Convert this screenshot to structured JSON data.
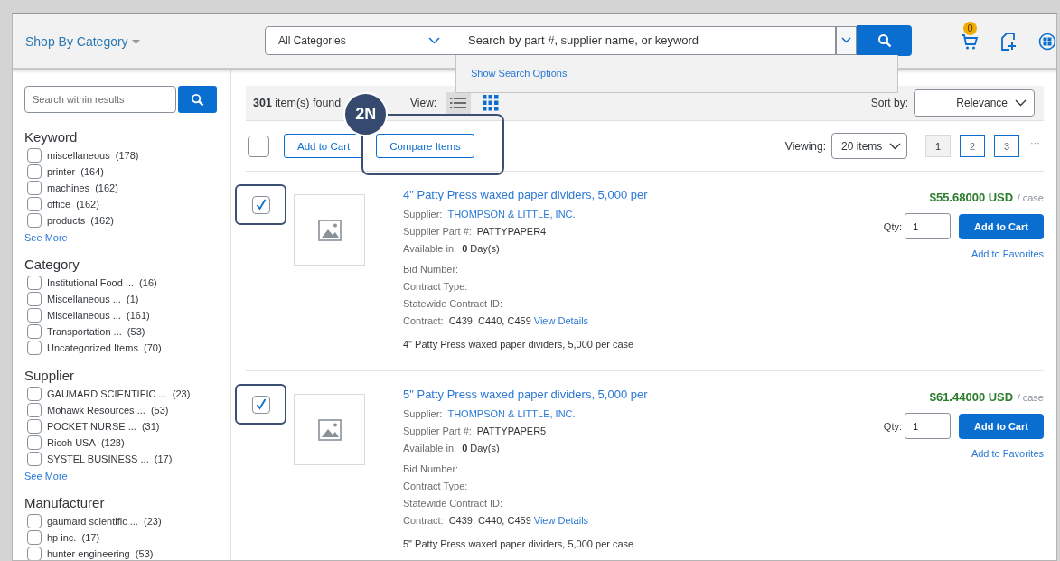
{
  "header": {
    "category_menu": "Shop By Category",
    "category_select": "All Categories",
    "search_placeholder": "Search by part #, supplier name, or keyword",
    "search_options_link": "Show Search Options",
    "cart_count": "0"
  },
  "sidebar": {
    "search_placeholder": "Search within results",
    "groups": [
      {
        "title": "Keyword",
        "see_more": "See More",
        "items": [
          {
            "label": "miscellaneous",
            "count": "(178)",
            "checked": false
          },
          {
            "label": "printer",
            "count": "(164)",
            "checked": false
          },
          {
            "label": "machines",
            "count": "(162)",
            "checked": false
          },
          {
            "label": "office",
            "count": "(162)",
            "checked": false
          },
          {
            "label": "products",
            "count": "(162)",
            "checked": false
          }
        ]
      },
      {
        "title": "Category",
        "items": [
          {
            "label": "Institutional Food ...",
            "count": "(16)",
            "checked": false
          },
          {
            "label": "Miscellaneous ...",
            "count": "(1)",
            "checked": false
          },
          {
            "label": "Miscellaneous ...",
            "count": "(161)",
            "checked": false
          },
          {
            "label": "Transportation ...",
            "count": "(53)",
            "checked": false
          },
          {
            "label": "Uncategorized Items",
            "count": "(70)",
            "checked": false
          }
        ]
      },
      {
        "title": "Supplier",
        "see_more": "See More",
        "items": [
          {
            "label": "GAUMARD SCIENTIFIC ...",
            "count": "(23)",
            "checked": false
          },
          {
            "label": "Mohawk Resources ...",
            "count": "(53)",
            "checked": false
          },
          {
            "label": "POCKET NURSE ...",
            "count": "(31)",
            "checked": false
          },
          {
            "label": "Ricoh USA",
            "count": "(128)",
            "checked": false
          },
          {
            "label": "SYSTEL BUSINESS ...",
            "count": "(17)",
            "checked": false
          }
        ]
      },
      {
        "title": "Manufacturer",
        "items": [
          {
            "label": "gaumard scientific ...",
            "count": "(23)",
            "checked": false
          },
          {
            "label": "hp inc.",
            "count": "(17)",
            "checked": false
          },
          {
            "label": "hunter engineering",
            "count": "(53)",
            "checked": false
          }
        ]
      }
    ]
  },
  "results": {
    "count": "301",
    "count_suffix": "item(s) found",
    "view_label": "View:",
    "view_modes": [
      {
        "kind": "list",
        "selected": true
      },
      {
        "kind": "grid",
        "selected": false
      }
    ],
    "sort_label": "Sort by:",
    "sort_value": "Relevance",
    "select_all_checked": false,
    "buttons": [
      {
        "label": "Add to Cart",
        "highlighted": false
      },
      {
        "label": "Compare Items",
        "highlighted": true
      }
    ],
    "viewing_label": "Viewing:",
    "viewing_value": "20 items",
    "pages": [
      {
        "label": "1",
        "selected": true
      },
      {
        "label": "2",
        "selected": false
      },
      {
        "label": "3",
        "selected": false
      }
    ],
    "more": "···"
  },
  "annotation": {
    "label": "2N"
  },
  "products": [
    {
      "checked": true,
      "highlighted": true,
      "title": "4\" Patty Press waxed paper dividers, 5,000 per",
      "supplier_label": "Supplier:",
      "supplier": "THOMPSON & LITTLE, INC.",
      "part_label": "Supplier Part #:",
      "part": "PATTYPAPER4",
      "available_label": "Available in:",
      "available_days": "0",
      "available_unit": "Day(s)",
      "fields": [
        "Bid Number:",
        "Contract Type:",
        "Statewide Contract ID:"
      ],
      "contract_label": "Contract:",
      "contract": "C439, C440, C459",
      "contract_link": "View Details",
      "description": "4\" Patty Press waxed paper dividers, 5,000 per case",
      "price": "$55.68000 USD",
      "unit": "/ case",
      "qty_label": "Qty:",
      "qty": "1",
      "add_button": "Add to Cart",
      "favorites_link": "Add to Favorites"
    },
    {
      "checked": true,
      "highlighted": true,
      "title": "5\" Patty Press waxed paper dividers, 5,000 per",
      "supplier_label": "Supplier:",
      "supplier": "THOMPSON & LITTLE, INC.",
      "part_label": "Supplier Part #:",
      "part": "PATTYPAPER5",
      "available_label": "Available in:",
      "available_days": "0",
      "available_unit": "Day(s)",
      "fields": [
        "Bid Number:",
        "Contract Type:",
        "Statewide Contract ID:"
      ],
      "contract_label": "Contract:",
      "contract": "C439, C440, C459",
      "contract_link": "View Details",
      "description": "5\" Patty Press waxed paper dividers, 5,000 per case",
      "price": "$61.44000 USD",
      "unit": "/ case",
      "qty_label": "Qty:",
      "qty": "1",
      "add_button": "Add to Cart",
      "favorites_link": "Add to Favorites"
    }
  ]
}
